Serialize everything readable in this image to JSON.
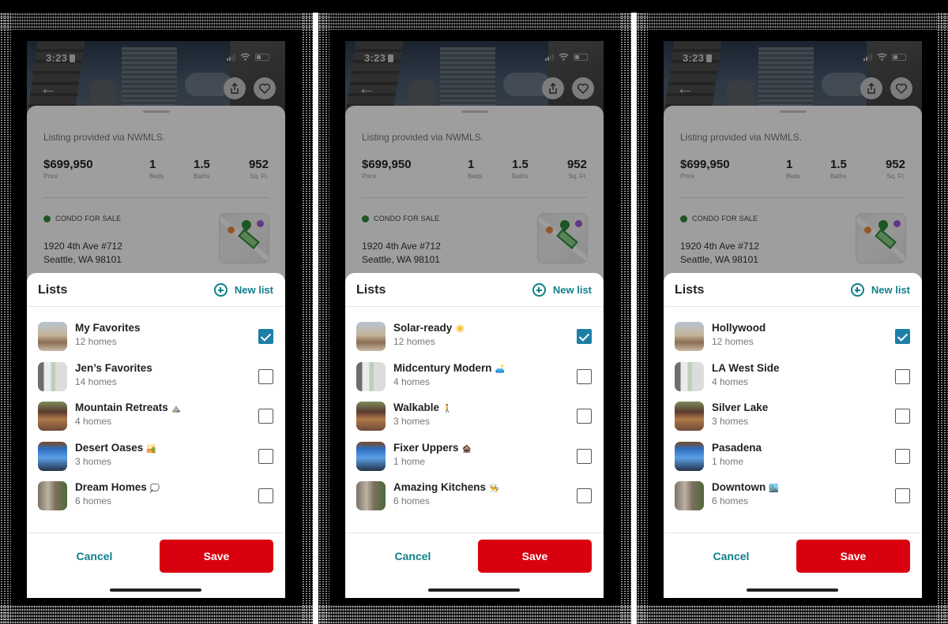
{
  "status_bar": {
    "time": "3:23"
  },
  "listing": {
    "source": "Listing provided via NWMLS.",
    "price": "$699,950",
    "price_label": "Price",
    "beds": "1",
    "beds_label": "Beds",
    "baths": "1.5",
    "baths_label": "Baths",
    "sqft": "952",
    "sqft_label": "Sq. Ft.",
    "status": "CONDO FOR SALE",
    "address_line1": "1920 4th Ave #712",
    "address_line2": "Seattle, WA 98101",
    "status_color": "#2e8b3a"
  },
  "sheet": {
    "title": "Lists",
    "new_list_label": "New list",
    "cancel_label": "Cancel",
    "save_label": "Save",
    "accent_color": "#11808a",
    "save_color": "#d9000f",
    "checkbox_color": "#1c7fa6"
  },
  "phones": [
    {
      "items": [
        {
          "name": "My Favorites",
          "emoji": "",
          "count": "12 homes",
          "checked": true
        },
        {
          "name": "Jen’s Favorites",
          "emoji": "",
          "count": "14 homes",
          "checked": false
        },
        {
          "name": "Mountain Retreats",
          "emoji": "⛰️",
          "count": "4 homes",
          "checked": false
        },
        {
          "name": "Desert Oases",
          "emoji": "🏜️",
          "count": "3 homes",
          "checked": false
        },
        {
          "name": "Dream Homes",
          "emoji": "💭",
          "count": "6 homes",
          "checked": false
        }
      ]
    },
    {
      "items": [
        {
          "name": "Solar-ready",
          "emoji": "☀️",
          "count": "12 homes",
          "checked": true
        },
        {
          "name": "Midcentury Modern",
          "emoji": "🛋️",
          "count": "4 homes",
          "checked": false
        },
        {
          "name": "Walkable",
          "emoji": "🚶",
          "count": "3 homes",
          "checked": false
        },
        {
          "name": "Fixer Uppers",
          "emoji": "🏚️",
          "count": "1 home",
          "checked": false
        },
        {
          "name": "Amazing Kitchens",
          "emoji": "👨‍🍳",
          "count": "6 homes",
          "checked": false
        }
      ]
    },
    {
      "items": [
        {
          "name": "Hollywood",
          "emoji": "",
          "count": "12 homes",
          "checked": true
        },
        {
          "name": "LA West Side",
          "emoji": "",
          "count": "4 homes",
          "checked": false
        },
        {
          "name": "Silver Lake",
          "emoji": "",
          "count": "3 homes",
          "checked": false
        },
        {
          "name": "Pasadena",
          "emoji": "",
          "count": "1 home",
          "checked": false
        },
        {
          "name": "Downtown",
          "emoji": "🏙️",
          "count": "6 homes",
          "checked": false
        }
      ]
    }
  ]
}
